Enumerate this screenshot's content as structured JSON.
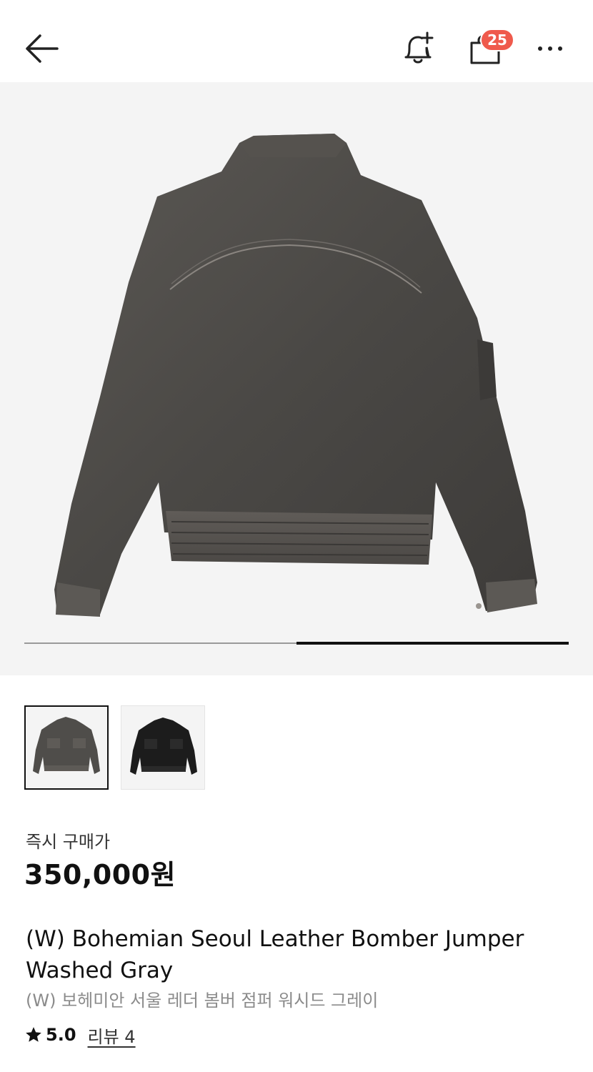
{
  "header": {
    "cart_count": "25"
  },
  "gallery": {
    "image_count": 2,
    "current_index": 2
  },
  "price": {
    "label": "즉시 구매가",
    "value": "350,000원"
  },
  "product": {
    "title": "(W) Bohemian Seoul Leather Bomber Jumper Washed Gray",
    "title_ko": "(W) 보헤미안 서울 레더 봄버 점퍼 워시드 그레이"
  },
  "rating": {
    "score": "5.0",
    "review_label": "리뷰 4"
  },
  "colors": {
    "badge": "#ef5a4c",
    "jacket_washed_gray": "#4f4d4a",
    "jacket_black": "#1c1c1c"
  },
  "icons": [
    "arrow-left-icon",
    "bell-plus-icon",
    "shopping-bag-icon",
    "more-horizontal-icon",
    "star-icon"
  ]
}
